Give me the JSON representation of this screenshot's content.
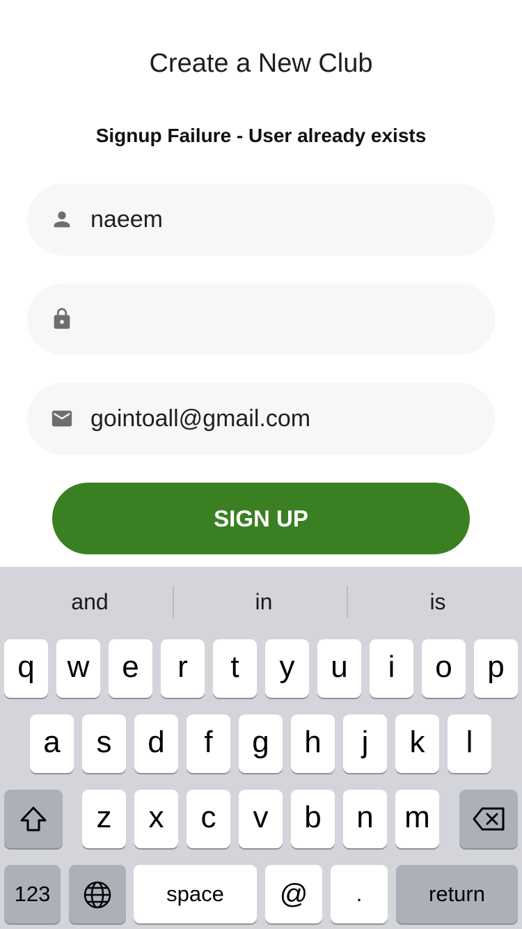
{
  "header": {
    "title": "Create a New Club",
    "error_message": "Signup Failure - User already exists"
  },
  "form": {
    "username": {
      "icon": "person-icon",
      "value": "naeem"
    },
    "password": {
      "icon": "lock-icon",
      "value": ""
    },
    "email": {
      "icon": "mail-icon",
      "value": "gointoall@gmail.com"
    },
    "submit_label": "SIGN UP"
  },
  "keyboard": {
    "suggestions": [
      "and",
      "in",
      "is"
    ],
    "row1": [
      "q",
      "w",
      "e",
      "r",
      "t",
      "y",
      "u",
      "i",
      "o",
      "p"
    ],
    "row2": [
      "a",
      "s",
      "d",
      "f",
      "g",
      "h",
      "j",
      "k",
      "l"
    ],
    "row3": [
      "z",
      "x",
      "c",
      "v",
      "b",
      "n",
      "m"
    ],
    "numbers_label": "123",
    "space_label": "space",
    "at_label": "@",
    "dot_label": ".",
    "return_label": "return",
    "shift_icon": "shift-icon",
    "backspace_icon": "backspace-icon",
    "globe_icon": "globe-icon"
  },
  "colors": {
    "accent": "#3a8022",
    "field_bg": "#f7f7f7",
    "keyboard_bg": "#d3d5da",
    "dark_key": "#abb0b9"
  }
}
